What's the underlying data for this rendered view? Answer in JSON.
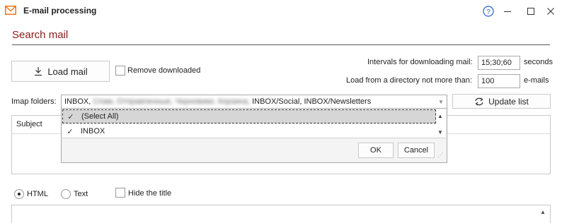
{
  "window": {
    "title": "E-mail processing",
    "icon": "envelope-icon",
    "accent": "#e87a1d",
    "controls": [
      "help-icon",
      "minimize-icon",
      "maximize-icon",
      "close-icon"
    ]
  },
  "section": {
    "title": "Search mail",
    "title_color": "#8b1a1a"
  },
  "load": {
    "button_label": "Load mail",
    "remove_downloaded_label": "Remove downloaded",
    "remove_downloaded_checked": false
  },
  "settings": {
    "intervals_label": "Intervals for downloading mail:",
    "intervals_value": "15;30;60",
    "intervals_unit": "seconds",
    "limit_label": "Load from a directory not more than:",
    "limit_value": "100",
    "limit_unit": "e-mails"
  },
  "folders": {
    "label": "Imap folders:",
    "value_prefix": "INBOX,",
    "value_blurred": "Спам, Отправленные, Черновики, Корзина,",
    "value_suffix": "INBOX/Social, INBOX/Newsletters",
    "update_button_label": "Update list",
    "options": [
      {
        "label": "(Select All)",
        "checked": true
      },
      {
        "label": "INBOX",
        "checked": true
      }
    ],
    "ok_label": "OK",
    "cancel_label": "Cancel"
  },
  "messages": {
    "column_subject": "Subject"
  },
  "view": {
    "html_label": "HTML",
    "text_label": "Text",
    "selected": "HTML",
    "hide_title_label": "Hide the title",
    "hide_title_checked": false
  }
}
